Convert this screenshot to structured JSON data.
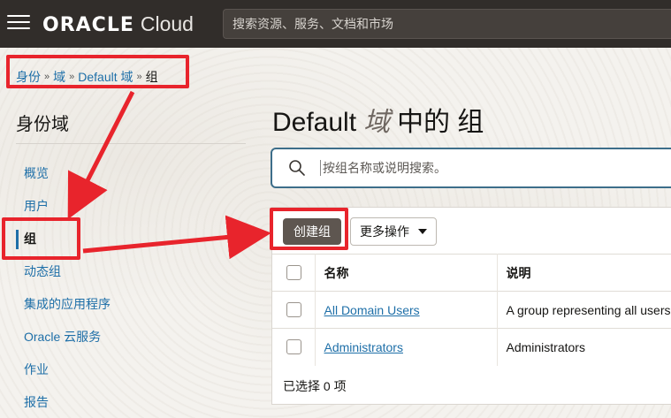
{
  "header": {
    "brand_oracle": "ORACLE",
    "brand_cloud": "Cloud",
    "search_placeholder": "搜索资源、服务、文档和市场"
  },
  "breadcrumb": {
    "items": [
      "身份",
      "域",
      "Default 域",
      "组"
    ],
    "separator": "»"
  },
  "sidebar": {
    "title": "身份域",
    "items": [
      {
        "label": "概览"
      },
      {
        "label": "用户"
      },
      {
        "label": "组",
        "active": true
      },
      {
        "label": "动态组"
      },
      {
        "label": "集成的应用程序"
      },
      {
        "label": "Oracle 云服务"
      },
      {
        "label": "作业"
      },
      {
        "label": "报告"
      }
    ]
  },
  "main": {
    "title_prefix": "Default",
    "title_italic": "域",
    "title_suffix": "中的 组",
    "search_placeholder": "按组名称或说明搜索。",
    "create_button": "创建组",
    "more_actions": "更多操作",
    "table": {
      "columns": [
        "名称",
        "说明"
      ],
      "rows": [
        {
          "name": "All Domain Users",
          "description": "A group representing all users"
        },
        {
          "name": "Administrators",
          "description": "Administrators"
        }
      ]
    },
    "selected_count": "已选择 0 项"
  },
  "colors": {
    "header_bg": "#312d2a",
    "link": "#1e6fa8",
    "annotation": "#e8242c",
    "primary_button": "#5e5650"
  }
}
